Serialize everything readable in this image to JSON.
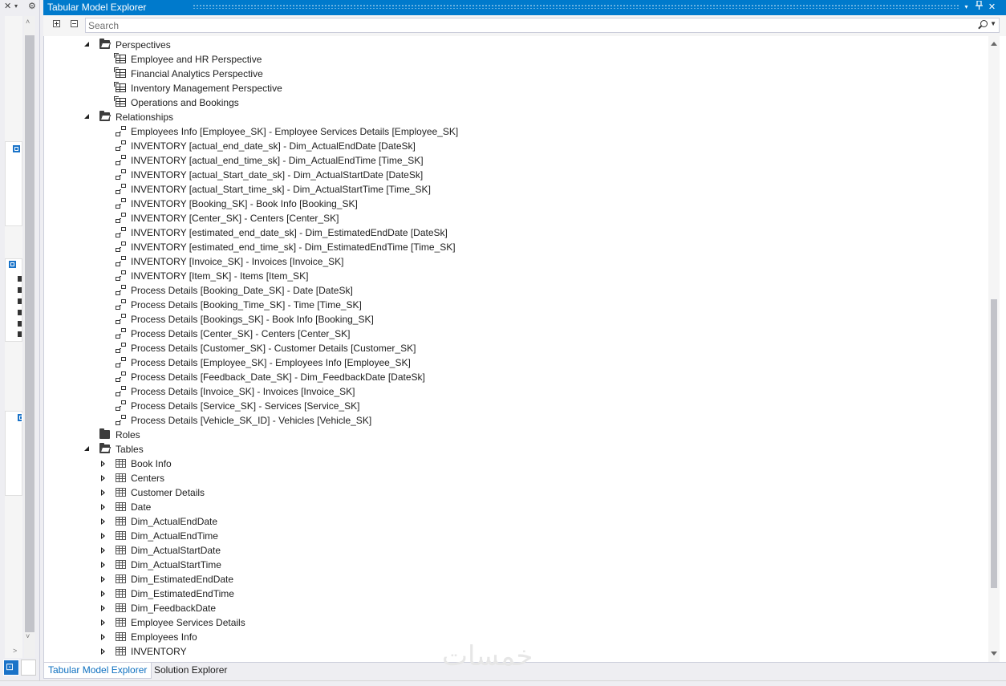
{
  "window": {
    "title": "Tabular Model Explorer",
    "pin_label": "⊥",
    "close_label": "✕",
    "dropdown_label": "▾"
  },
  "left_strip": {
    "close_label": "✕",
    "dropdown_label": "▾",
    "settings_label": "⚙",
    "scroll_up_label": "˄",
    "scroll_down_label": "˅",
    "scroll_right_label": ">"
  },
  "toolbar": {
    "search_placeholder": "Search",
    "search_value": ""
  },
  "tree": {
    "perspectives": {
      "label": "Perspectives",
      "items": [
        "Employee and HR Perspective",
        "Financial Analytics Perspective",
        "Inventory Management Perspective",
        "Operations and Bookings"
      ]
    },
    "relationships": {
      "label": "Relationships",
      "items": [
        "Employees Info [Employee_SK] - Employee Services Details [Employee_SK]",
        "INVENTORY [actual_end_date_sk] - Dim_ActualEndDate [DateSk]",
        "INVENTORY [actual_end_time_sk] - Dim_ActualEndTime [Time_SK]",
        "INVENTORY [actual_Start_date_sk] - Dim_ActualStartDate [DateSk]",
        "INVENTORY [actual_Start_time_sk] - Dim_ActualStartTime [Time_SK]",
        "INVENTORY [Booking_SK] - Book Info [Booking_SK]",
        "INVENTORY [Center_SK] - Centers [Center_SK]",
        "INVENTORY [estimated_end_date_sk] - Dim_EstimatedEndDate [DateSk]",
        "INVENTORY [estimated_end_time_sk] - Dim_EstimatedEndTime [Time_SK]",
        "INVENTORY [Invoice_SK] - Invoices [Invoice_SK]",
        "INVENTORY [Item_SK] - Items [Item_SK]",
        "Process Details [Booking_Date_SK] - Date [DateSk]",
        "Process Details [Booking_Time_SK] - Time [Time_SK]",
        "Process Details [Bookings_SK] - Book Info [Booking_SK]",
        "Process Details [Center_SK] - Centers [Center_SK]",
        "Process Details [Customer_SK] - Customer Details [Customer_SK]",
        "Process Details [Employee_SK] - Employees Info [Employee_SK]",
        "Process Details [Feedback_Date_SK] - Dim_FeedbackDate [DateSk]",
        "Process Details [Invoice_SK] - Invoices [Invoice_SK]",
        "Process Details [Service_SK] - Services [Service_SK]",
        "Process Details [Vehicle_SK_ID] - Vehicles [Vehicle_SK]"
      ]
    },
    "roles": {
      "label": "Roles"
    },
    "tables": {
      "label": "Tables",
      "items": [
        "Book Info",
        "Centers",
        "Customer Details",
        "Date",
        "Dim_ActualEndDate",
        "Dim_ActualEndTime",
        "Dim_ActualStartDate",
        "Dim_ActualStartTime",
        "Dim_EstimatedEndDate",
        "Dim_EstimatedEndTime",
        "Dim_FeedbackDate",
        "Employee Services Details",
        "Employees Info",
        "INVENTORY"
      ]
    }
  },
  "bottom_tabs": [
    "Tabular Model Explorer",
    "Solution Explorer"
  ],
  "watermark": "خمسات",
  "colors": {
    "titlebar": "#007acc",
    "active_tab_text": "#0e70c0",
    "background": "#eeeef2"
  }
}
